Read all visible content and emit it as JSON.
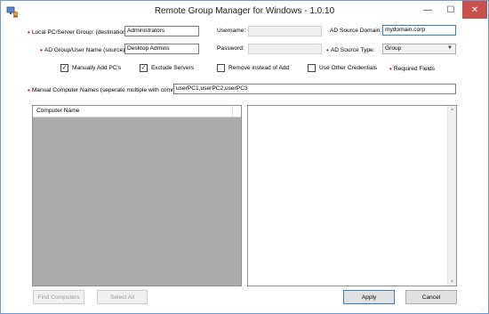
{
  "window": {
    "title": "Remote Group Manager for Windows - 1.0.10"
  },
  "form": {
    "local_group_label": "Local PC/Server Group: (destination)",
    "local_group_value": "Administrators",
    "ad_group_label": "AD Group/User Name (source):",
    "ad_group_value": "Desktop Admins",
    "username_label": "Username:",
    "username_value": "",
    "password_label": "Password:",
    "password_value": "",
    "ad_domain_label": "AD Source Domain:",
    "ad_domain_value": "mydomain.corp",
    "ad_type_label": "AD Source Type:",
    "ad_type_value": "Group",
    "manual_names_label": "Manual Computer Names (seperate multiple with comma's):",
    "manual_names_value": "userPC1,userPC2,userPC3",
    "required_note": "Required Fields"
  },
  "options": {
    "manually_add_pcs": {
      "label": "Manually Add PC's",
      "checked": true
    },
    "exclude_servers": {
      "label": "Exclude Servers",
      "checked": true
    },
    "remove_instead": {
      "label": "Remove instead of Add",
      "checked": false
    },
    "use_other_credentials": {
      "label": "Use Other Credentials",
      "checked": false
    }
  },
  "computer_list": {
    "column_header": "Computer Name",
    "rows": []
  },
  "buttons": {
    "find_computers": "Find Computers",
    "select_all": "Select All",
    "apply": "Apply",
    "cancel": "Cancel"
  },
  "colors": {
    "required_marker": "#cc0000",
    "close_button": "#c7504a",
    "list_background": "#ababab"
  },
  "icons": {
    "required_marker": "•",
    "minimize": "—",
    "maximize": "☐",
    "close": "✕",
    "check": "✓",
    "scroll_up": "▲",
    "scroll_down": "▼",
    "dropdown_arrow": "▼",
    "resize_grip": "⋰"
  }
}
